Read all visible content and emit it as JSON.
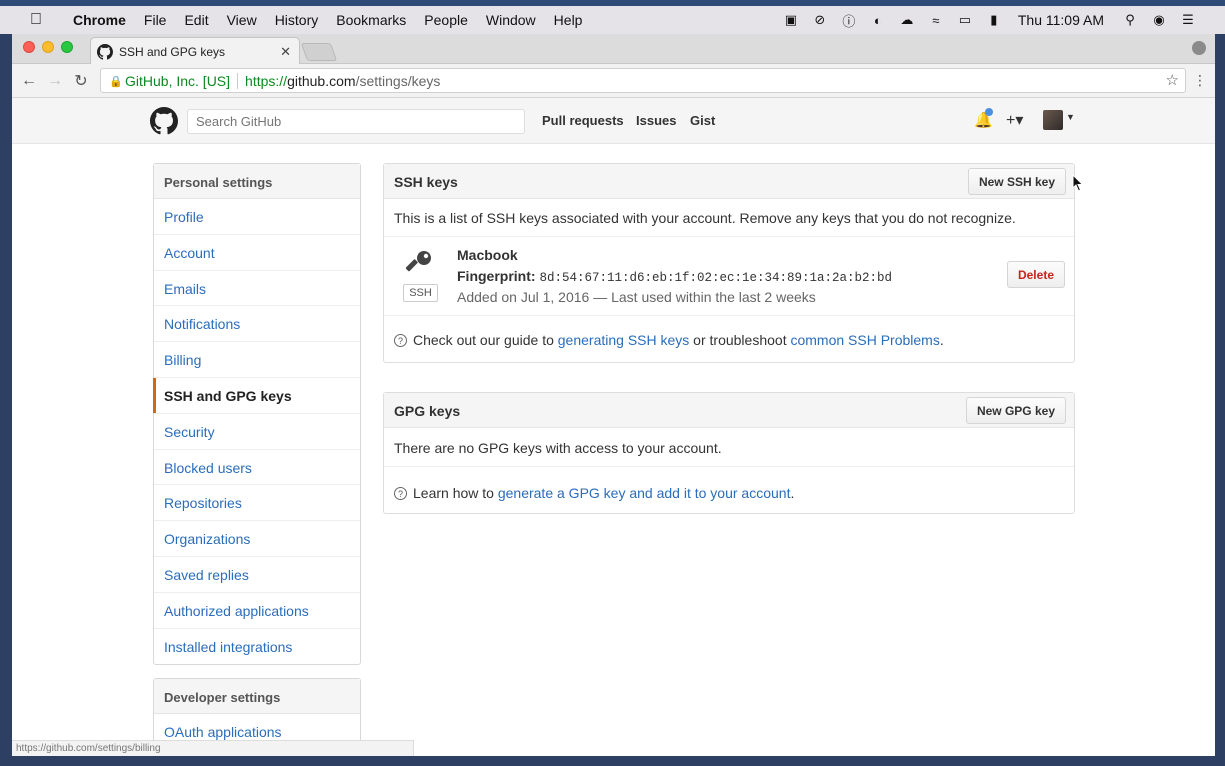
{
  "menubar": {
    "items": [
      "Chrome",
      "File",
      "Edit",
      "View",
      "History",
      "Bookmarks",
      "People",
      "Window",
      "Help"
    ],
    "clock": "Thu 11:09 AM"
  },
  "browser": {
    "tab_title": "SSH and GPG keys",
    "ev_cert": "GitHub, Inc. [US]",
    "url_protocol": "https://",
    "url_host": "github.com",
    "url_path": "/settings/keys",
    "status_url": "https://github.com/settings/billing"
  },
  "gh_header": {
    "search_placeholder": "Search GitHub",
    "nav": [
      "Pull requests",
      "Issues",
      "Gist"
    ]
  },
  "sidebar": {
    "personal_heading": "Personal settings",
    "items": [
      {
        "label": "Profile"
      },
      {
        "label": "Account"
      },
      {
        "label": "Emails"
      },
      {
        "label": "Notifications"
      },
      {
        "label": "Billing"
      },
      {
        "label": "SSH and GPG keys",
        "selected": true
      },
      {
        "label": "Security"
      },
      {
        "label": "Blocked users"
      },
      {
        "label": "Repositories"
      },
      {
        "label": "Organizations"
      },
      {
        "label": "Saved replies"
      },
      {
        "label": "Authorized applications"
      },
      {
        "label": "Installed integrations"
      }
    ],
    "developer_heading": "Developer settings",
    "developer_items": [
      {
        "label": "OAuth applications"
      }
    ]
  },
  "ssh": {
    "title": "SSH keys",
    "new_button": "New SSH key",
    "intro": "This is a list of SSH keys associated with your account. Remove any keys that you do not recognize.",
    "keys": [
      {
        "badge": "SSH",
        "name": "Macbook",
        "fingerprint_label": "Fingerprint:",
        "fingerprint": "8d:54:67:11:d6:eb:1f:02:ec:1e:34:89:1a:2a:b2:bd",
        "meta": "Added on Jul 1, 2016 — Last used within the last 2 weeks",
        "delete_label": "Delete"
      }
    ],
    "guide_prefix": "Check out our guide to ",
    "guide_link1": "generating SSH keys",
    "guide_mid": " or troubleshoot ",
    "guide_link2": "common SSH Problems",
    "guide_suffix": "."
  },
  "gpg": {
    "title": "GPG keys",
    "new_button": "New GPG key",
    "empty": "There are no GPG keys with access to your account.",
    "guide_prefix": "Learn how to ",
    "guide_link": "generate a GPG key and add it to your account",
    "guide_suffix": "."
  },
  "colors": {
    "link": "#2a6dbb",
    "selected_accent": "#d26911",
    "danger": "#c8241c",
    "secure_green": "#0b8a1f"
  }
}
